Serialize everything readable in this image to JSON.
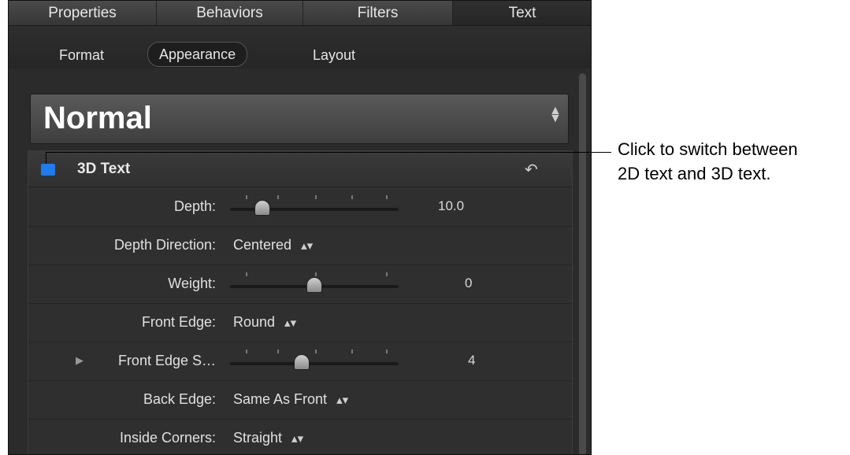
{
  "tabs": [
    {
      "label": "Properties"
    },
    {
      "label": "Behaviors"
    },
    {
      "label": "Filters"
    },
    {
      "label": "Text"
    }
  ],
  "subtabs": [
    {
      "label": "Format"
    },
    {
      "label": "Appearance"
    },
    {
      "label": "Layout"
    }
  ],
  "preset": {
    "name": "Normal"
  },
  "group": {
    "title": "3D Text",
    "enabled": true
  },
  "rows": [
    {
      "label": "Depth:",
      "value": "10.0",
      "slider": 0.16
    },
    {
      "label": "Depth Direction:",
      "value": "Centered"
    },
    {
      "label": "Weight:",
      "value": "0",
      "slider": 0.5
    },
    {
      "label": "Front Edge:",
      "value": "Round"
    },
    {
      "label": "Front Edge S…",
      "value": "4",
      "slider": 0.42
    },
    {
      "label": "Back Edge:",
      "value": "Same As Front"
    },
    {
      "label": "Inside Corners:",
      "value": "Straight"
    }
  ],
  "callout": {
    "line1": "Click to switch between",
    "line2": "2D text and 3D text."
  },
  "colors": {
    "toggle": "#1e7bf0",
    "panel": "#2b2b2b"
  }
}
